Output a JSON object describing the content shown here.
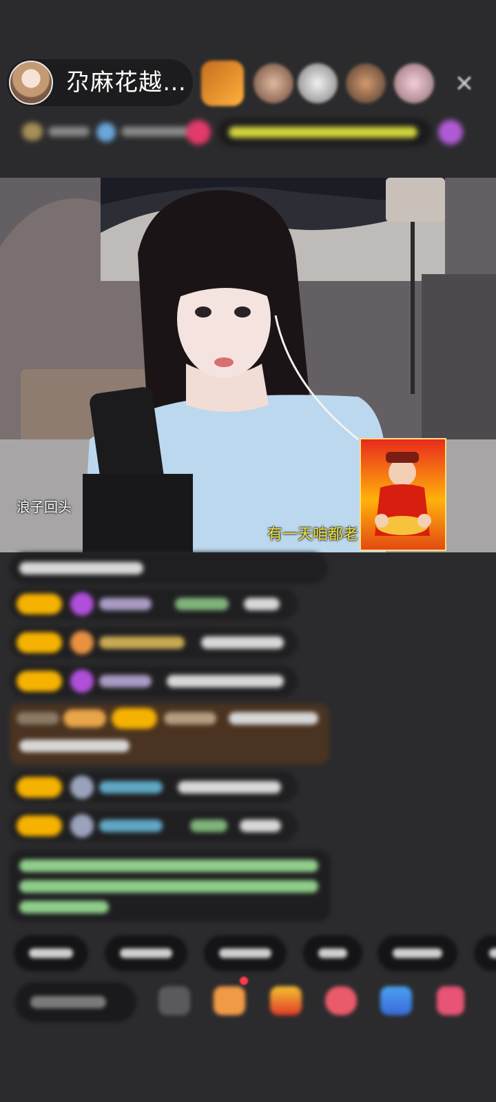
{
  "header": {
    "host_name": "尕麻花越…",
    "close_icon": "close-icon"
  },
  "video": {
    "lyric_left": "浪子回头",
    "lyric_right": "有一天咱都老"
  },
  "colors": {
    "background": "#2b2b2d",
    "badge": "#f6b200",
    "lyric_yellow": "#f4e53b"
  }
}
